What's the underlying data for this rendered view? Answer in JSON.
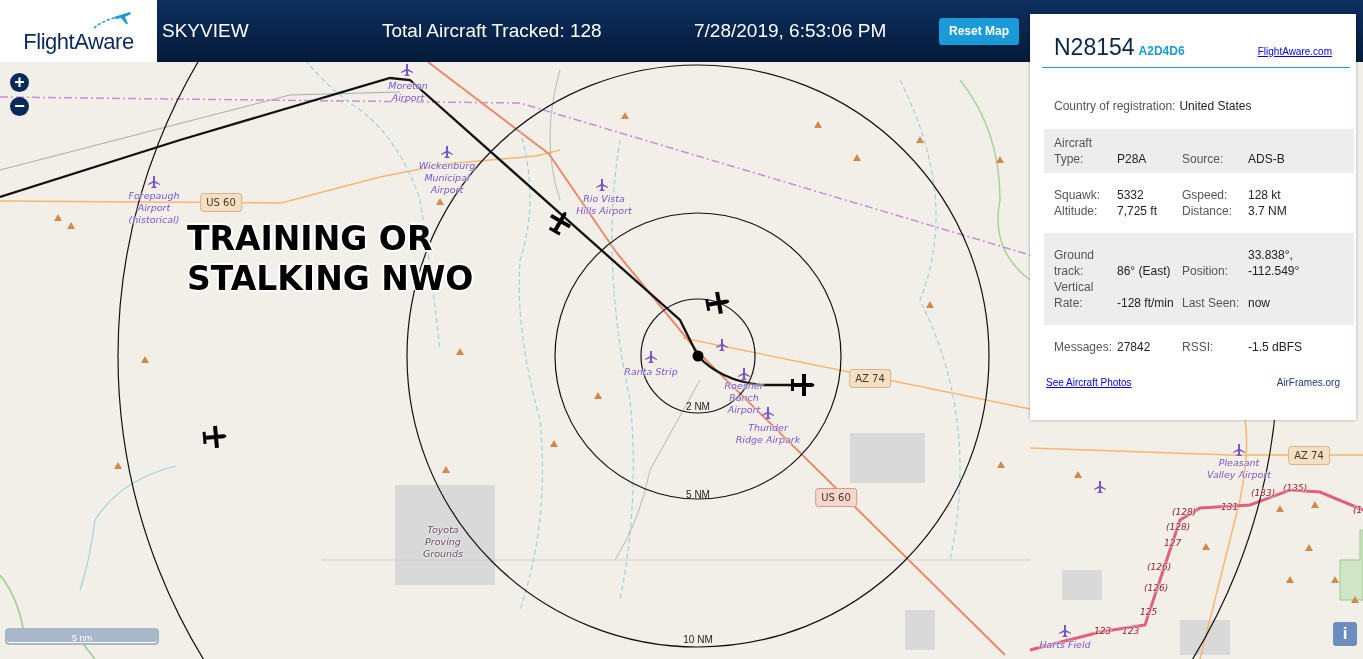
{
  "header": {
    "logo": "FlightAware",
    "title": "SKYVIEW",
    "tracked": "Total Aircraft Tracked: 128",
    "datetime": "7/28/2019, 6:53:06 PM",
    "button": "Reset Map"
  },
  "zoom_controls": [
    {
      "symbol": "+"
    },
    {
      "symbol": "−"
    }
  ],
  "map": {
    "overlay_text": [
      "TRAINING OR",
      "STALKING NWO"
    ],
    "ring_labels": [
      "2 NM",
      "5 NM",
      "10 NM"
    ],
    "places": [
      {
        "kind": "airport",
        "lines": [
          "Moreton",
          "Airport"
        ]
      },
      {
        "kind": "airport",
        "lines": [
          "Wickenburg",
          "Municipal",
          "Airport"
        ]
      },
      {
        "kind": "airport",
        "lines": [
          "Forepaugh",
          "Airport",
          "(historical)"
        ]
      },
      {
        "kind": "airport",
        "lines": [
          "Rio Vista",
          "Hills Airport"
        ]
      },
      {
        "kind": "airport",
        "lines": [
          "Ranta Strip"
        ]
      },
      {
        "kind": "airport",
        "lines": [
          "Roesner",
          "Ranch",
          "Airport"
        ]
      },
      {
        "kind": "airport",
        "lines": [
          "Thunder",
          "Ridge Airpark"
        ]
      },
      {
        "kind": "airport",
        "lines": [
          "Pleasant",
          "Valley Airport"
        ]
      },
      {
        "kind": "airport",
        "lines": [
          "Harts Field"
        ]
      },
      {
        "kind": "area",
        "lines": [
          "Toyota",
          "Proving",
          "Grounds"
        ]
      }
    ],
    "road_shields": [
      {
        "kind": "state",
        "label": "US 60"
      },
      {
        "kind": "state",
        "label": "AZ 74"
      },
      {
        "kind": "us",
        "label": "US 60"
      },
      {
        "kind": "state",
        "label": "AZ 74"
      }
    ],
    "exit_numbers": [
      "(135)",
      "(133)",
      "(128)",
      "131",
      "(1",
      "(128)",
      "127",
      "(126)",
      "(126)",
      "125",
      "123",
      "123"
    ],
    "scale": "5 nm",
    "info_button": "i"
  },
  "panel": {
    "registration": "N28154",
    "hex": "A2D4D6",
    "link": "FlightAware.com",
    "country_label": "Country of registration:",
    "country": "United States",
    "sections": [
      {
        "shaded": true,
        "rows": [
          [
            {
              "label": "Aircraft Type:",
              "value": "P28A"
            },
            {
              "label": "Source:",
              "value": "ADS-B"
            }
          ]
        ]
      },
      {
        "shaded": false,
        "rows": [
          [
            {
              "label": "Squawk:",
              "value": "5332"
            },
            {
              "label": "Gspeed:",
              "value": "128 kt"
            }
          ],
          [
            {
              "label": "Altitude:",
              "value": "7,725 ft"
            },
            {
              "label": "Distance:",
              "value": "3.7 NM"
            }
          ]
        ]
      },
      {
        "shaded": true,
        "rows": [
          [
            {
              "label": "Ground track:",
              "value": "86° (East)"
            },
            {
              "label": "Position:",
              "value": "33.838°, -112.549°"
            }
          ],
          [
            {
              "label": "Vertical Rate:",
              "value": "-128 ft/min"
            },
            {
              "label": "Last Seen:",
              "value": "now"
            }
          ]
        ]
      },
      {
        "shaded": false,
        "rows": [
          [
            {
              "label": "Messages:",
              "value": "27842"
            },
            {
              "label": "RSSI:",
              "value": "-1.5 dBFS"
            }
          ]
        ]
      }
    ],
    "photos_link": "See Aircraft Photos",
    "airframes_link": "AirFrames.org"
  }
}
